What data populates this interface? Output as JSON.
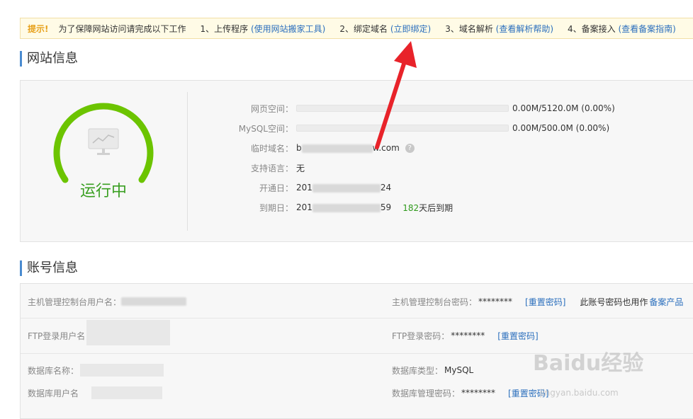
{
  "notice": {
    "label": "提示!",
    "intro": "为了保障网站访问请完成以下工作",
    "step1": "1、上传程序",
    "step1_link": "(使用网站搬家工具)",
    "step2": "2、绑定域名",
    "step2_link": "(立即绑定)",
    "step3": "3、域名解析",
    "step3_link": "(查看解析帮助)",
    "step4": "4、备案接入",
    "step4_link": "(查看备案指南)"
  },
  "site": {
    "title": "网站信息",
    "status": "运行中",
    "web_space_label": "网页空间：",
    "web_space_value": "0.00M/5120.0M (0.00%)",
    "web_space_fraction": 0,
    "mysql_space_label": "MySQL空间：",
    "mysql_space_value": "0.00M/500.0M (0.00%)",
    "mysql_space_fraction": 0,
    "temp_domain_label": "临时域名：",
    "temp_domain_prefix": "b",
    "temp_domain_suffix": "w.com",
    "language_label": "支持语言：",
    "language_value": "无",
    "open_label": "开通日：",
    "open_prefix": "201",
    "open_suffix": "24",
    "expire_label": "到期日：",
    "expire_prefix": "201",
    "expire_suffix": "59",
    "days_left": "182",
    "days_left_text": "天后到期"
  },
  "account": {
    "title": "账号信息",
    "console_user_label": "主机管理控制台用户名：",
    "console_pwd_label": "主机管理控制台密码：",
    "console_pwd_value": "********",
    "reset_label": "[重置密码]",
    "shared_note": "此账号密码也用作",
    "shared_link": "备案产品",
    "ftp_user_label": "FTP登录用户名",
    "ftp_pwd_label": "FTP登录密码：",
    "ftp_pwd_value": "********",
    "db_name_label": "数据库名称：",
    "db_type_label": "数据库类型：",
    "db_type_value": "MySQL",
    "db_user_label": "数据库用户名",
    "db_pwd_label": "数据库管理密码：",
    "db_pwd_value": "********"
  },
  "watermark": {
    "brand": "Baidu经验",
    "url": "jingyan.baidu.com"
  },
  "colors": {
    "accent": "#4a8bd0",
    "gauge": "#6cc400",
    "status": "#3a9f22",
    "link": "#2b6fbd",
    "arrow": "#e8232a"
  }
}
